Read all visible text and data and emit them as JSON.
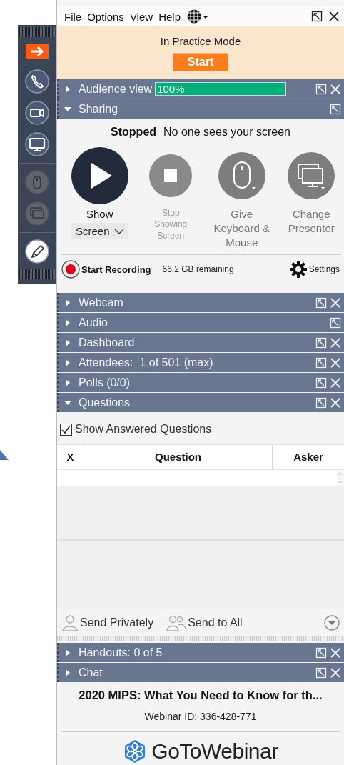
{
  "menu": [
    "File",
    "Options",
    "View",
    "Help"
  ],
  "practice": {
    "text": "In Practice Mode",
    "button": "Start"
  },
  "toolbar": [
    {
      "kind": "arrow",
      "enabled": true
    },
    {
      "kind": "phone",
      "enabled": true
    },
    {
      "kind": "camera",
      "enabled": true
    },
    {
      "kind": "monitor",
      "enabled": true
    },
    {
      "kind": "mouse",
      "enabled": false
    },
    {
      "kind": "screens",
      "enabled": false
    },
    {
      "kind": "pencil",
      "enabled": true
    }
  ],
  "panels": [
    {
      "kind": "meter",
      "title": "Audience view",
      "expanded": false,
      "closable": true,
      "level": 1,
      "reading": "100%"
    },
    {
      "kind": "sharing",
      "title": "Sharing",
      "expanded": true,
      "closable": false
    },
    {
      "kind": "plain",
      "title": "Webcam",
      "expanded": false,
      "closable": true
    },
    {
      "kind": "plain",
      "title": "Audio",
      "expanded": false,
      "closable": false
    },
    {
      "kind": "plain",
      "title": "Dashboard",
      "expanded": false,
      "closable": true
    },
    {
      "kind": "plain",
      "title": "Attendees:  1 of 501 (max)",
      "expanded": false,
      "closable": true
    },
    {
      "kind": "plain",
      "title": "Polls (0/0)",
      "expanded": false,
      "closable": true
    },
    {
      "kind": "questions",
      "title": "Questions",
      "expanded": true,
      "closable": true
    },
    {
      "kind": "plain",
      "title": "Handouts: 0 of 5",
      "expanded": false,
      "closable": true
    },
    {
      "kind": "plain",
      "title": "Chat",
      "expanded": false,
      "closable": true
    }
  ],
  "sharing": {
    "status": "Stopped",
    "status_text": "No one sees your screen",
    "actions": [
      {
        "kind": "play",
        "label": "Show",
        "enabled": true,
        "dropdown": "Screen"
      },
      {
        "kind": "stop",
        "label": "Stop Showing Screen",
        "enabled": false
      },
      {
        "kind": "mouse",
        "label": "Give Keyboard & Mouse",
        "enabled": true
      },
      {
        "kind": "screens",
        "label": "Change Presenter",
        "enabled": true
      }
    ],
    "recording": "Start Recording",
    "remaining": "66.2 GB remaining",
    "settings": "Settings"
  },
  "questions": {
    "show_answered": {
      "label": "Show Answered Questions",
      "checked": true
    },
    "columns": [
      "X",
      "Question",
      "Asker"
    ],
    "send_privately": "Send Privately",
    "send_all": "Send to All"
  },
  "webinar": {
    "title": "2020 MIPS: What You Need to Know for th...",
    "id": "Webinar ID: 336-428-771",
    "logo": "**GoTo**Webinar"
  }
}
